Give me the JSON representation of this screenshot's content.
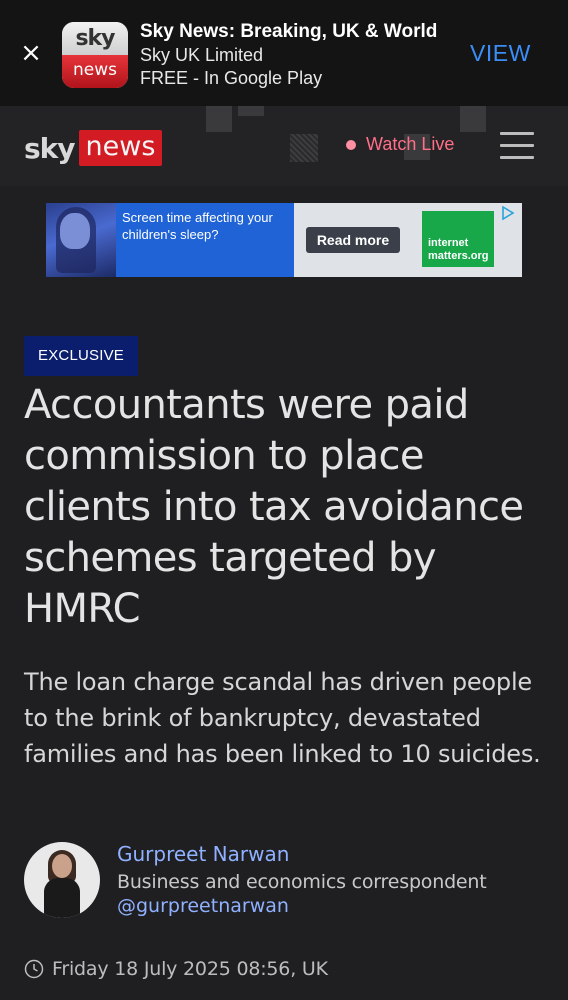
{
  "app_banner": {
    "close_glyph": "×",
    "logo_top": "sky",
    "logo_bottom": "news",
    "title": "Sky News: Breaking, UK & World",
    "publisher": "Sky UK Limited",
    "price": "FREE - In Google Play",
    "view_label": "VIEW"
  },
  "header": {
    "logo_sky": "sky",
    "logo_news": "news",
    "watch_live": "Watch Live",
    "accent_color": "#d21b23"
  },
  "ad": {
    "headline": "Screen time affecting your children's sleep?",
    "cta": "Read more",
    "brand": "internet matters.org"
  },
  "article": {
    "badge": "EXCLUSIVE",
    "headline": "Accountants were paid commission to place clients into tax avoidance schemes targeted by HMRC",
    "standfirst": "The loan charge scandal has driven people to the brink of bankruptcy, devastated families and has been linked to 10 suicides.",
    "author": {
      "name": "Gurpreet Narwan",
      "role": "Business and economics correspondent",
      "handle": "@gurpreetnarwan"
    },
    "date": "Friday 18 July 2025 08:56, UK"
  }
}
